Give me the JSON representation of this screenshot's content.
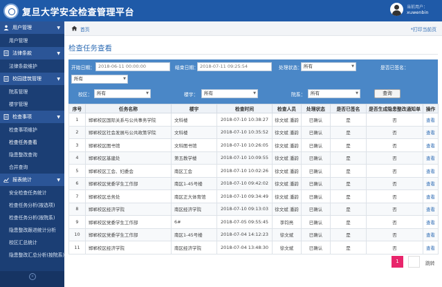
{
  "header": {
    "title": "复旦大学安全检查管理平台",
    "user_label": "当前用户：",
    "user_name": "xuwenbin"
  },
  "sidebar": {
    "groups": [
      {
        "label": "用户管理",
        "icon": "user-icon",
        "items": [
          "用户管理"
        ]
      },
      {
        "label": "法律条款",
        "icon": "document-icon",
        "items": [
          "法律条款维护"
        ]
      },
      {
        "label": "校园建筑管理",
        "icon": "document-icon",
        "items": [
          "院系管理",
          "楼宇管理"
        ]
      },
      {
        "label": "检查事项",
        "icon": "document-icon",
        "items": [
          "检查事项维护",
          "检查任务查看",
          "隐患整改查询",
          "合并查询"
        ]
      },
      {
        "label": "报表统计",
        "icon": "chart-icon",
        "items": [
          "安全检查任务统计",
          "检查任务分析(按选项)",
          "检查任务分析(按院系)",
          "隐患整改跟进统计分析",
          "校区汇总统计",
          "隐患整改汇总分析(按院系)"
        ]
      }
    ]
  },
  "breadcrumb": {
    "home": "首页",
    "print": "*打印当前页"
  },
  "page_title": "检查任务查看",
  "filters": {
    "start_label": "开始日期：",
    "start_value": "2018-06-11 00:00:00",
    "end_label": "结束日期：",
    "end_value": "2018-07-11 09:25:54",
    "status_label": "处理状态：",
    "status_value": "所有",
    "signed_label": "是否已签名：",
    "signed_value": "所有",
    "campus_label": "校区：",
    "campus_value": "所有",
    "building_label": "楼宇：",
    "building_value": "所有",
    "dept_label": "院系：",
    "dept_value": "所有",
    "query_button": "查询"
  },
  "table": {
    "headers": [
      "序号",
      "任务名称",
      "楼宇",
      "检查时间",
      "检查人员",
      "处理状态",
      "是否已签名",
      "是否生成隐患整改通知单",
      "操作"
    ],
    "rows": [
      [
        "1",
        "邯郸校区国际关系与公共事务学院",
        "文科楼",
        "2018-07-10 10:38:27",
        "徐文斌 潘韵",
        "已确认",
        "是",
        "否",
        "查看"
      ],
      [
        "2",
        "邯郸校区社会发展与公共政策学院",
        "文科楼",
        "2018-07-10 10:35:52",
        "徐文斌 潘韵",
        "已确认",
        "是",
        "否",
        "查看"
      ],
      [
        "3",
        "邯郸校区图书馆",
        "文科图书馆",
        "2018-07-10 10:26:05",
        "徐文斌 潘韵",
        "已确认",
        "是",
        "否",
        "查看"
      ],
      [
        "4",
        "邯郸校区基建处",
        "第五教学楼",
        "2018-07-10 10:09:55",
        "徐文斌 潘韵",
        "已确认",
        "是",
        "否",
        "查看"
      ],
      [
        "5",
        "邯郸校区工会、妇委会",
        "南区工会",
        "2018-07-10 10:02:26",
        "徐文斌 潘韵",
        "已确认",
        "是",
        "否",
        "查看"
      ],
      [
        "6",
        "邯郸校区党委学生工作部",
        "南区1-45号楼",
        "2018-07-10 09:42:02",
        "徐文斌 潘韵",
        "已确认",
        "是",
        "否",
        "查看"
      ],
      [
        "7",
        "邯郸校区总务处",
        "南区正大体育馆",
        "2018-07-10 09:34:49",
        "徐文斌 潘韵",
        "已确认",
        "是",
        "否",
        "查看"
      ],
      [
        "8",
        "邯郸校区经济学院",
        "南区经济学院",
        "2018-07-10 09:13:03",
        "徐文斌 潘韵",
        "已确认",
        "是",
        "否",
        "查看"
      ],
      [
        "9",
        "邯郸校区党委学生工作部",
        "6#",
        "2018-07-05 09:55:45",
        "李钧亮",
        "已确认",
        "是",
        "否",
        "查看"
      ],
      [
        "10",
        "邯郸校区党委学生工作部",
        "南区1-45号楼",
        "2018-07-04 14:12:23",
        "徐文斌",
        "已确认",
        "是",
        "否",
        "查看"
      ],
      [
        "11",
        "邯郸校区经济学院",
        "南区经济学院",
        "2018-07-04 13:48:30",
        "徐文斌",
        "已确认",
        "是",
        "否",
        "查看"
      ]
    ]
  },
  "pager": {
    "current": "1",
    "jump": "跳转"
  },
  "colors": {
    "header": "#1f5aa8",
    "sidebar": "#1b3e74",
    "filter_bar": "#4a87c7",
    "accent": "#e8256b",
    "link": "#2f6db5"
  }
}
